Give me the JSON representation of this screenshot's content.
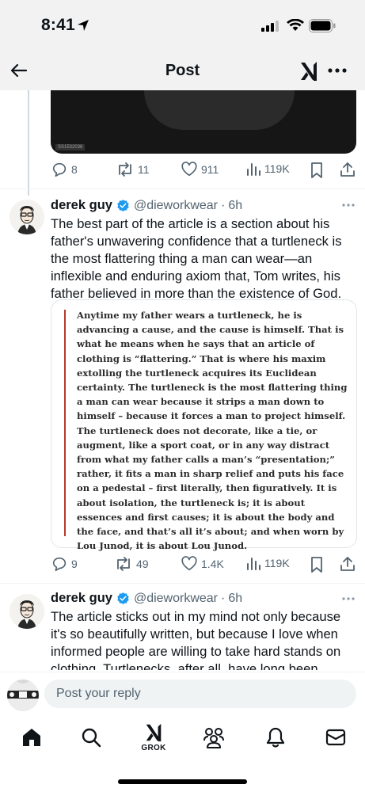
{
  "status_bar": {
    "time": "8:41"
  },
  "header": {
    "title": "Post"
  },
  "media": {
    "badge": "SS1532036"
  },
  "tweet0_actions": {
    "replies": "8",
    "reposts": "11",
    "likes": "911",
    "views": "119K"
  },
  "tweet1": {
    "name": "derek guy",
    "handle": "@dieworkwear",
    "separator": "·",
    "time": "6h",
    "text": "The best part of the article is a section about his father's unwavering confidence that a turtleneck is the most flattering thing a man can wear—an inflexible and enduring axiom that, Tom writes, his father believed in more than the existence of God.",
    "quote": "Anytime my father wears a turtleneck, he is advancing a cause, and the cause is himself. That is what he means when he says that an article of clothing is “flattering.” That is where his maxim extolling the turtleneck acquires its Euclidean certainty. The turtleneck is the most flattering thing a man can wear because it strips a man down to himself – because it forces a man to project himself. The turtleneck does not decorate, like a tie, or augment, like a sport coat, or in any way distract from what my father calls a man’s “presentation;” rather, it fits a man in sharp relief and puts his face on a pedestal – first literally, then figuratively. It is about isolation, the turtleneck is; it is about essences and first causes; it is about the body and the face, and that’s all it’s about; and when worn by Lou Junod, it is about Lou Junod.",
    "replies": "9",
    "reposts": "49",
    "likes": "1.4K",
    "views": "119K"
  },
  "tweet2": {
    "name": "derek guy",
    "handle": "@dieworkwear",
    "separator": "·",
    "time": "6h",
    "text": "The article sticks out in my mind not only because it's so beautifully written, but because I love when informed people are willing to take hard stands on clothing. Turtlenecks, after all, have long been"
  },
  "reply_bar": {
    "placeholder": "Post your reply"
  },
  "tabbar": {
    "grok_label": "GROK"
  },
  "colors": {
    "verified": "#1d9bf0",
    "quote_bar": "#b53a2f",
    "muted": "#536471"
  }
}
